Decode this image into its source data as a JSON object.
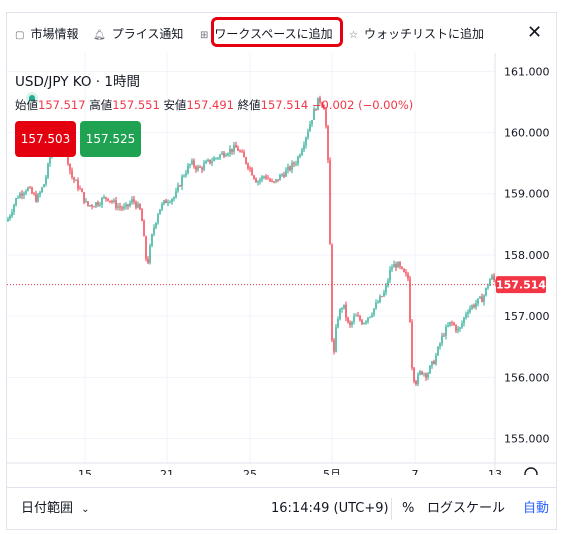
{
  "toolbar": {
    "market_info": "市場情報",
    "price_alert": "プライス通知",
    "add_workspace": "ワークスペースに追加",
    "add_watchlist": "ウォッチリストに追加"
  },
  "legend": {
    "symbol": "USD/JPY KO · 1時間",
    "open_label": "始値",
    "open": "157.517",
    "high_label": "高値",
    "high": "157.551",
    "low_label": "安値",
    "low": "157.491",
    "close_label": "終値",
    "close": "157.514",
    "change": "−0.002 (−0.00%)",
    "sell_price": "157.503",
    "buy_price": "157.525"
  },
  "bottom_bar": {
    "date_range": "日付範囲",
    "time": "16:14:49 (UTC+9)",
    "percent": "%",
    "log_scale": "ログスケール",
    "auto": "自動"
  },
  "colors": {
    "up": "#22ab94",
    "down": "#f23645",
    "sell_box": "#e4000f",
    "buy_box": "#1fa353",
    "highlight": "#e4000f",
    "link": "#2962ff"
  },
  "chart_data": {
    "type": "candlestick",
    "ylim": [
      154.6,
      161.3
    ],
    "y_ticks": [
      "161.000",
      "160.000",
      "159.000",
      "158.000",
      "157.000",
      "156.000",
      "155.000"
    ],
    "x_ticks": [
      "15",
      "21",
      "25",
      "5月",
      "7",
      "13"
    ],
    "last_price": "157.514",
    "last_value": 157.514,
    "close_path": [
      [
        0,
        158.55
      ],
      [
        10,
        158.95
      ],
      [
        20,
        159.1
      ],
      [
        30,
        158.9
      ],
      [
        38,
        159.2
      ],
      [
        45,
        159.75
      ],
      [
        52,
        159.85
      ],
      [
        58,
        159.8
      ],
      [
        64,
        159.3
      ],
      [
        72,
        159.1
      ],
      [
        80,
        158.8
      ],
      [
        90,
        158.85
      ],
      [
        100,
        158.95
      ],
      [
        110,
        158.8
      ],
      [
        118,
        158.75
      ],
      [
        126,
        158.9
      ],
      [
        134,
        158.7
      ],
      [
        140,
        157.8
      ],
      [
        146,
        158.4
      ],
      [
        152,
        158.75
      ],
      [
        160,
        158.9
      ],
      [
        168,
        158.95
      ],
      [
        176,
        159.3
      ],
      [
        184,
        159.5
      ],
      [
        192,
        159.4
      ],
      [
        200,
        159.5
      ],
      [
        210,
        159.6
      ],
      [
        220,
        159.7
      ],
      [
        230,
        159.75
      ],
      [
        240,
        159.5
      ],
      [
        250,
        159.2
      ],
      [
        258,
        159.3
      ],
      [
        266,
        159.15
      ],
      [
        274,
        159.3
      ],
      [
        282,
        159.4
      ],
      [
        290,
        159.55
      ],
      [
        298,
        159.9
      ],
      [
        306,
        160.3
      ],
      [
        312,
        160.55
      ],
      [
        318,
        160.4
      ],
      [
        322,
        159.2
      ],
      [
        324,
        157.1
      ],
      [
        326,
        156.2
      ],
      [
        330,
        156.95
      ],
      [
        336,
        157.2
      ],
      [
        342,
        156.8
      ],
      [
        348,
        157.0
      ],
      [
        356,
        156.9
      ],
      [
        364,
        157.05
      ],
      [
        372,
        157.25
      ],
      [
        378,
        157.4
      ],
      [
        384,
        157.8
      ],
      [
        390,
        157.85
      ],
      [
        396,
        157.7
      ],
      [
        402,
        157.6
      ],
      [
        404,
        156.3
      ],
      [
        408,
        155.9
      ],
      [
        414,
        156.1
      ],
      [
        420,
        156.05
      ],
      [
        428,
        156.3
      ],
      [
        436,
        156.7
      ],
      [
        444,
        156.9
      ],
      [
        452,
        156.75
      ],
      [
        460,
        157.1
      ],
      [
        468,
        157.2
      ],
      [
        476,
        157.3
      ],
      [
        484,
        157.65
      ],
      [
        490,
        157.514
      ]
    ]
  }
}
